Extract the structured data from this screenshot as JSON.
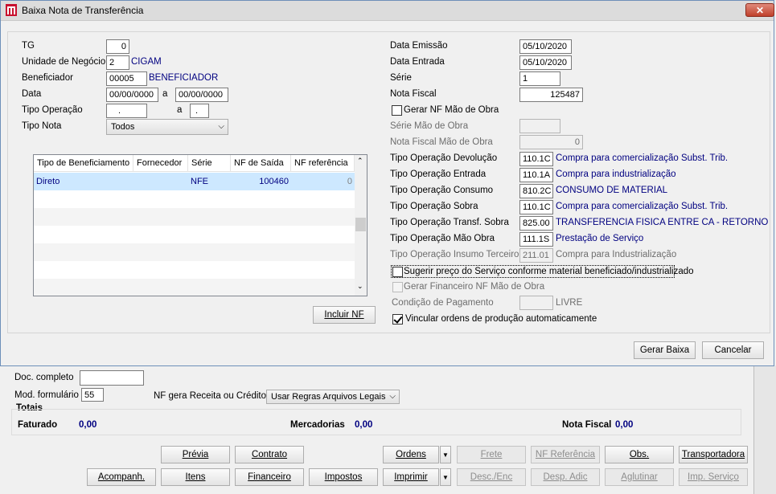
{
  "dialog": {
    "title": "Baixa Nota de Transferência",
    "close": "✕"
  },
  "left": {
    "tg_label": "TG",
    "tg_value": "0",
    "un_label": "Unidade de Negócio",
    "un_value": "2",
    "un_name": "CIGAM",
    "benef_label": "Beneficiador",
    "benef_value": "00005",
    "benef_name": "BENEFICIADOR",
    "data_label": "Data",
    "data_from": "00/00/0000",
    "data_sep": "a",
    "data_to": "00/00/0000",
    "tipo_op_label": "Tipo Operação",
    "tipo_op_from": ".",
    "tipo_op_sep": "a",
    "tipo_op_to": ".",
    "tipo_nota_label": "Tipo Nota",
    "tipo_nota_value": "Todos"
  },
  "grid": {
    "columns": [
      "Tipo de Beneficiamento",
      "Fornecedor",
      "Série",
      "NF de Saída",
      "NF referência"
    ],
    "rows": [
      [
        "Direto",
        "",
        "NFE",
        "100460",
        "0"
      ]
    ]
  },
  "incluir_nf": "Incluir NF",
  "right": {
    "data_emissao_label": "Data Emissão",
    "data_emissao": "05/10/2020",
    "data_entrada_label": "Data Entrada",
    "data_entrada": "05/10/2020",
    "serie_label": "Série",
    "serie": "1",
    "nota_fiscal_label": "Nota Fiscal",
    "nota_fiscal": "125487",
    "gerar_nf_mo": "Gerar NF Mão de Obra",
    "serie_mo_label": "Série Mão de Obra",
    "serie_mo": "",
    "nf_mo_label": "Nota Fiscal Mão de Obra",
    "nf_mo": "0",
    "ops": [
      {
        "label": "Tipo Operação Devolução",
        "code": "110.1C",
        "desc": "Compra para comercialização Subst. Trib."
      },
      {
        "label": "Tipo Operação Entrada",
        "code": "110.1A",
        "desc": "Compra para industrialização"
      },
      {
        "label": "Tipo Operação Consumo",
        "code": "810.2C",
        "desc": "CONSUMO DE MATERIAL"
      },
      {
        "label": "Tipo Operação Sobra",
        "code": "110.1C",
        "desc": "Compra para comercialização Subst. Trib."
      },
      {
        "label": "Tipo Operação Transf. Sobra",
        "code": "825.00",
        "desc": "TRANSFERENCIA FISICA ENTRE CA - RETORNO"
      },
      {
        "label": "Tipo Operação Mão Obra",
        "code": "111.1S",
        "desc": "Prestação de Serviço"
      },
      {
        "label": "Tipo Operação Insumo Terceiro",
        "code": "211.01",
        "desc": "Compra para Industrialização"
      }
    ],
    "sugerir": "Sugerir preço do Serviço conforme material beneficiado/industrializado",
    "gerar_financeiro": "Gerar Financeiro NF Mão de Obra",
    "cond_pag_label": "Condição de Pagamento",
    "cond_pag_value": "",
    "cond_pag_desc": "LIVRE",
    "vincular": "Vincular ordens de produção automaticamente"
  },
  "footer": {
    "gerar_baixa": "Gerar Baixa",
    "cancelar": "Cancelar"
  },
  "background": {
    "doc_completo_label": "Doc. completo",
    "doc_completo_value": "",
    "mod_form_label": "Mod. formulário",
    "mod_form_value": "55",
    "nf_receita_label": "NF gera Receita ou Crédito",
    "nf_receita_value": "Usar Regras Arquivos Legais",
    "totais_label": "Totais",
    "faturado_label": "Faturado",
    "faturado_value": "0,00",
    "mercadorias_label": "Mercadorias",
    "mercadorias_value": "0,00",
    "nota_fiscal_label": "Nota Fiscal",
    "nota_fiscal_value": "0,00",
    "buttons_row1": [
      "Prévia",
      "Contrato",
      "Ordens",
      "Frete",
      "NF Referência",
      "Obs.",
      "Transportadora"
    ],
    "buttons_row2": [
      "Acompanh.",
      "Itens",
      "Financeiro",
      "Impostos",
      "Imprimir",
      "Desc./Enc",
      "Desp. Adic",
      "Aglutinar",
      "Imp. Serviço"
    ]
  }
}
